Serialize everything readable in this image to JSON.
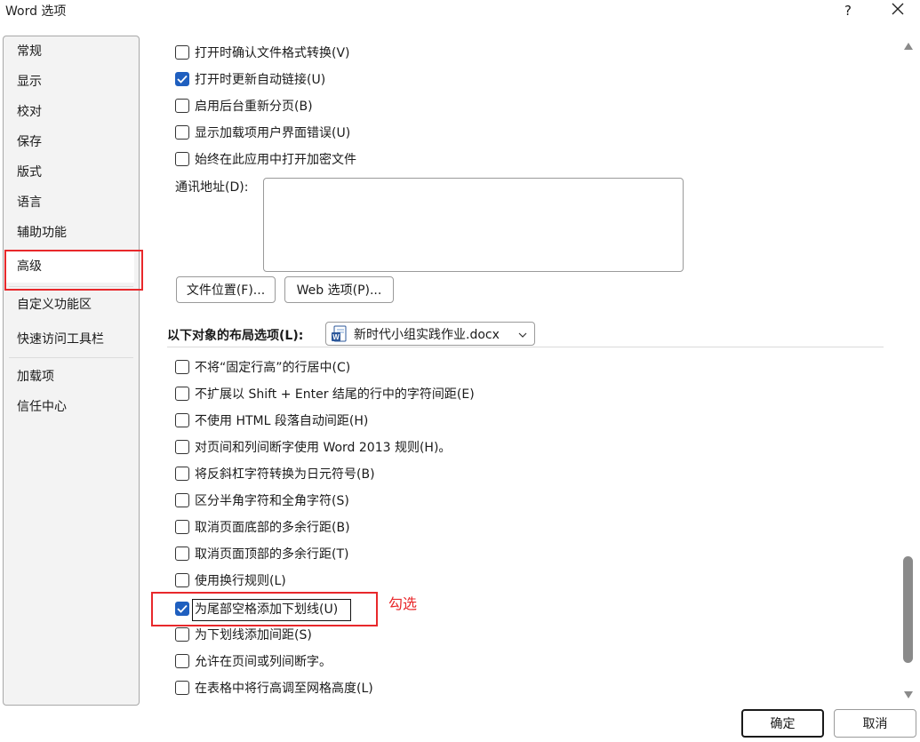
{
  "window": {
    "title": "Word 选项",
    "help_label": "?",
    "close_icon": "close-icon"
  },
  "sidebar": {
    "items": [
      {
        "label": "常规"
      },
      {
        "label": "显示"
      },
      {
        "label": "校对"
      },
      {
        "label": "保存"
      },
      {
        "label": "版式"
      },
      {
        "label": "语言"
      },
      {
        "label": "辅助功能"
      },
      {
        "label": "高级",
        "selected": true
      },
      {
        "label": "自定义功能区"
      },
      {
        "label": "快速访问工具栏"
      },
      {
        "label": "加载项"
      },
      {
        "label": "信任中心"
      }
    ]
  },
  "general_options": [
    {
      "label": "打开时确认文件格式转换(V)",
      "checked": false
    },
    {
      "label": "打开时更新自动链接(U)",
      "checked": true
    },
    {
      "label": "启用后台重新分页(B)",
      "checked": false
    },
    {
      "label": "显示加载项用户界面错误(U)",
      "checked": false
    },
    {
      "label": "始终在此应用中打开加密文件",
      "checked": false
    }
  ],
  "mailing_address": {
    "label": "通讯地址(D):",
    "value": ""
  },
  "buttons": {
    "file_locations": "文件位置(F)...",
    "web_options": "Web 选项(P)..."
  },
  "layout_section": {
    "label": "以下对象的布局选项(L):",
    "document": "新时代小组实践作业.docx",
    "document_icon": "word-doc-icon",
    "options": [
      {
        "label": "不将“固定行高”的行居中(C)",
        "checked": false
      },
      {
        "label": "不扩展以 Shift + Enter 结尾的行中的字符间距(E)",
        "checked": false
      },
      {
        "label": "不使用 HTML 段落自动间距(H)",
        "checked": false
      },
      {
        "label": "对页间和列间断字使用 Word 2013 规则(H)。",
        "checked": false
      },
      {
        "label": "将反斜杠字符转换为日元符号(B)",
        "checked": false
      },
      {
        "label": "区分半角字符和全角字符(S)",
        "checked": false
      },
      {
        "label": "取消页面底部的多余行距(B)",
        "checked": false
      },
      {
        "label": "取消页面顶部的多余行距(T)",
        "checked": false
      },
      {
        "label": "使用换行规则(L)",
        "checked": false
      },
      {
        "label": "为尾部空格添加下划线(U)",
        "checked": true
      },
      {
        "label": "为下划线添加间距(S)",
        "checked": false
      },
      {
        "label": "允许在页间或列间断字。",
        "checked": false
      },
      {
        "label": "在表格中将行高调至网格高度(L)",
        "checked": false
      }
    ]
  },
  "annotation": {
    "text": "勾选",
    "color": "#e8282b"
  },
  "footer": {
    "ok_label": "确定",
    "cancel_label": "取消"
  },
  "colors": {
    "accent": "#1f5fbf",
    "highlight": "#e8282b"
  }
}
